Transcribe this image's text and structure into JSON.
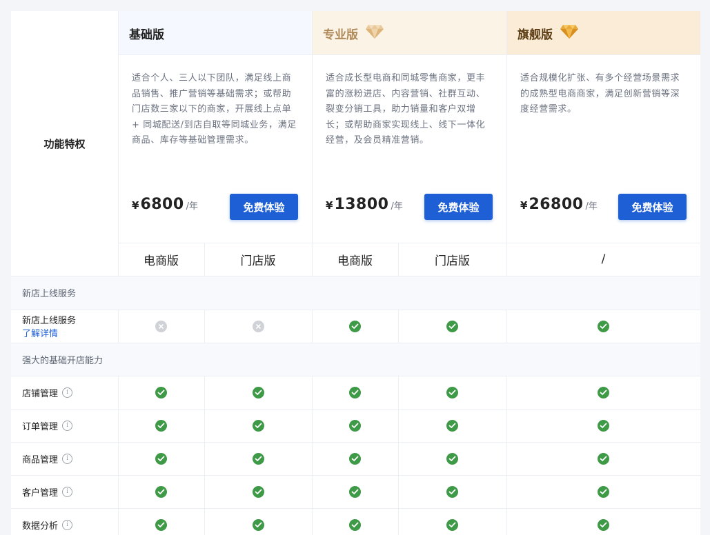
{
  "header": {
    "feature_label": "功能特权"
  },
  "plans": [
    {
      "name": "基础版",
      "gem": "",
      "description": "适合个人、三人以下团队，满足线上商品销售、推广营销等基础需求；或帮助门店数三家以下的商家，开展线上点单 + 同城配送/到店自取等同城业务，满足商品、库存等基础管理需求。",
      "currency": "¥",
      "price": "6800",
      "unit": "/年",
      "button": "免费体验"
    },
    {
      "name": "专业版",
      "gem": "diamond-icon",
      "description": "适合成长型电商和同城零售商家，更丰富的涨粉进店、内容营销、社群互动、裂变分销工具，助力销量和客户双增长；或帮助商家实现线上、线下一体化经营，及会员精准营销。",
      "currency": "¥",
      "price": "13800",
      "unit": "/年",
      "button": "免费体验"
    },
    {
      "name": "旗舰版",
      "gem": "diamond-icon",
      "description": "适合规模化扩张、有多个经营场景需求的成熟型电商商家，满足创新营销等深度经营需求。",
      "currency": "¥",
      "price": "26800",
      "unit": "/年",
      "button": "免费体验"
    }
  ],
  "subcolumns": [
    "电商版",
    "门店版",
    "电商版",
    "门店版",
    "/"
  ],
  "sections": [
    {
      "title": "新店上线服务",
      "rows": [
        {
          "label": "新店上线服务",
          "link": "了解详情",
          "info": false,
          "values": [
            "no",
            "no",
            "yes",
            "yes",
            "yes"
          ]
        }
      ]
    },
    {
      "title": "强大的基础开店能力",
      "rows": [
        {
          "label": "店铺管理",
          "info": true,
          "values": [
            "yes",
            "yes",
            "yes",
            "yes",
            "yes"
          ]
        },
        {
          "label": "订单管理",
          "info": true,
          "values": [
            "yes",
            "yes",
            "yes",
            "yes",
            "yes"
          ]
        },
        {
          "label": "商品管理",
          "info": true,
          "values": [
            "yes",
            "yes",
            "yes",
            "yes",
            "yes"
          ]
        },
        {
          "label": "客户管理",
          "info": true,
          "values": [
            "yes",
            "yes",
            "yes",
            "yes",
            "yes"
          ]
        },
        {
          "label": "数据分析",
          "info": true,
          "values": [
            "yes",
            "yes",
            "yes",
            "yes",
            "yes"
          ]
        }
      ]
    }
  ],
  "colors": {
    "accent": "#1f5fd6",
    "check": "#3f9a47",
    "cross": "#cfd2d6",
    "pro_head": "#fbf3e6",
    "flag_head": "#faecd6",
    "basic_head": "#f5f8fe",
    "pro_title": "#b08a5a",
    "flag_title": "#5a3b12"
  }
}
